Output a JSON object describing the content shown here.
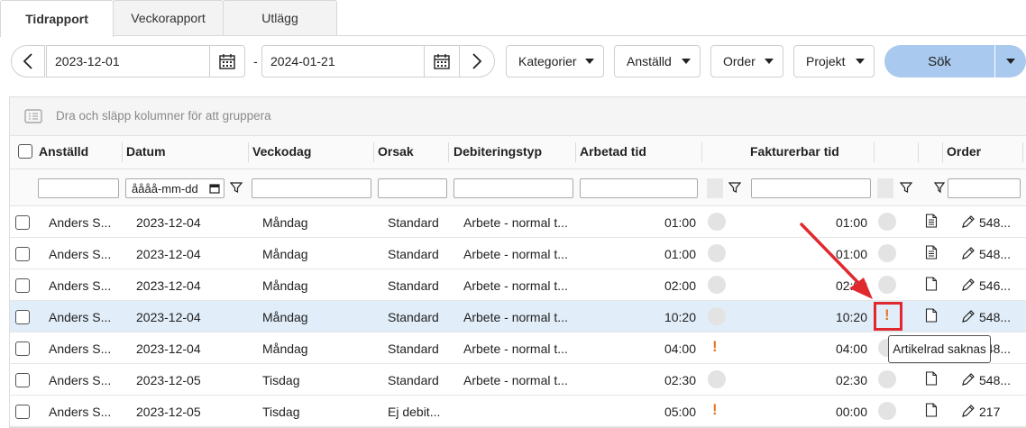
{
  "tabs": [
    {
      "label": "Tidrapport",
      "active": true
    },
    {
      "label": "Veckorapport",
      "active": false
    },
    {
      "label": "Utlägg",
      "active": false
    }
  ],
  "toolbar": {
    "date_from": "2023-12-01",
    "date_separator": "-",
    "date_to": "2024-01-21",
    "filters": [
      "Kategorier",
      "Anställd",
      "Order",
      "Projekt"
    ],
    "search_label": "Sök"
  },
  "grid": {
    "group_hint": "Dra och släpp kolumner för att gruppera",
    "columns": {
      "employee": "Anställd",
      "date": "Datum",
      "weekday": "Veckodag",
      "reason": "Orsak",
      "billing_type": "Debiteringstyp",
      "worked": "Arbetad tid",
      "billable": "Fakturerbar tid",
      "order": "Order"
    },
    "date_filter_placeholder": "åååå-mm-dd",
    "rows": [
      {
        "employee": "Anders S...",
        "date": "2023-12-04",
        "weekday": "Måndag",
        "reason": "Standard",
        "billing_type": "Arbete - normal t...",
        "worked": "01:00",
        "worked_status": "ok",
        "billable": "01:00",
        "billable_status": "ok",
        "doc_icon": "document-lines-icon",
        "order": "548...",
        "selected": false
      },
      {
        "employee": "Anders S...",
        "date": "2023-12-04",
        "weekday": "Måndag",
        "reason": "Standard",
        "billing_type": "Arbete - normal t...",
        "worked": "01:00",
        "worked_status": "ok",
        "billable": "01:00",
        "billable_status": "ok",
        "doc_icon": "document-lines-icon",
        "order": "548...",
        "selected": false
      },
      {
        "employee": "Anders S...",
        "date": "2023-12-04",
        "weekday": "Måndag",
        "reason": "Standard",
        "billing_type": "Arbete - normal t...",
        "worked": "02:00",
        "worked_status": "ok",
        "billable": "02:00",
        "billable_status": "ok",
        "doc_icon": "document-icon",
        "order": "546...",
        "selected": false
      },
      {
        "employee": "Anders S...",
        "date": "2023-12-04",
        "weekday": "Måndag",
        "reason": "Standard",
        "billing_type": "Arbete - normal t...",
        "worked": "10:20",
        "worked_status": "ok",
        "billable": "10:20",
        "billable_status": "warning",
        "doc_icon": "document-icon",
        "order": "548...",
        "selected": true
      },
      {
        "employee": "Anders S...",
        "date": "2023-12-04",
        "weekday": "Måndag",
        "reason": "Standard",
        "billing_type": "Arbete - normal t...",
        "worked": "04:00",
        "worked_status": "warning",
        "billable": "04:00",
        "billable_status": "ok",
        "doc_icon": "document-icon",
        "order": "548...",
        "selected": false
      },
      {
        "employee": "Anders S...",
        "date": "2023-12-05",
        "weekday": "Tisdag",
        "reason": "Standard",
        "billing_type": "Arbete - normal t...",
        "worked": "02:30",
        "worked_status": "ok",
        "billable": "02:30",
        "billable_status": "ok",
        "doc_icon": "document-icon",
        "order": "548...",
        "selected": false
      },
      {
        "employee": "Anders S...",
        "date": "2023-12-05",
        "weekday": "Tisdag",
        "reason": "Ej debit...",
        "billing_type": "",
        "worked": "05:00",
        "worked_status": "warning",
        "billable": "00:00",
        "billable_status": "ok",
        "doc_icon": "document-icon",
        "order": "217",
        "selected": false
      }
    ]
  },
  "tooltip": "Artikelrad saknas",
  "colors": {
    "accent": "#a9c9ef",
    "warning": "#e8782a",
    "highlight": "#e0292f",
    "selected_row": "#e1edf9"
  }
}
